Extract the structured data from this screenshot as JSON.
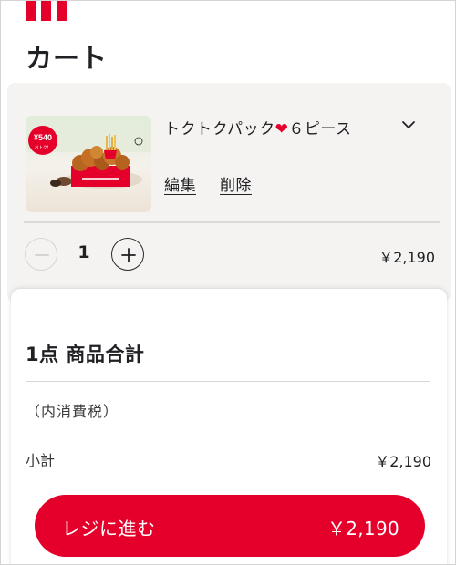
{
  "header": {
    "title": "カート",
    "brand_color": "#e4002b"
  },
  "cart": {
    "item": {
      "name_before_heart": "トクトクパック",
      "heart": "❤",
      "name_after_heart": "６ピース",
      "thumbnail_badge": "¥540",
      "thumbnail_badge_sub": "おトク！",
      "edit_label": "編集",
      "delete_label": "削除",
      "expand_icon": "chevron-down-icon",
      "quantity": "1",
      "price": "￥2,190"
    }
  },
  "summary": {
    "title": "1点 商品合計",
    "tax_note": "（内消費税）",
    "subtotal_label": "小計",
    "subtotal_value": "￥2,190",
    "checkout_label": "レジに進む",
    "checkout_total": "￥2,190"
  }
}
